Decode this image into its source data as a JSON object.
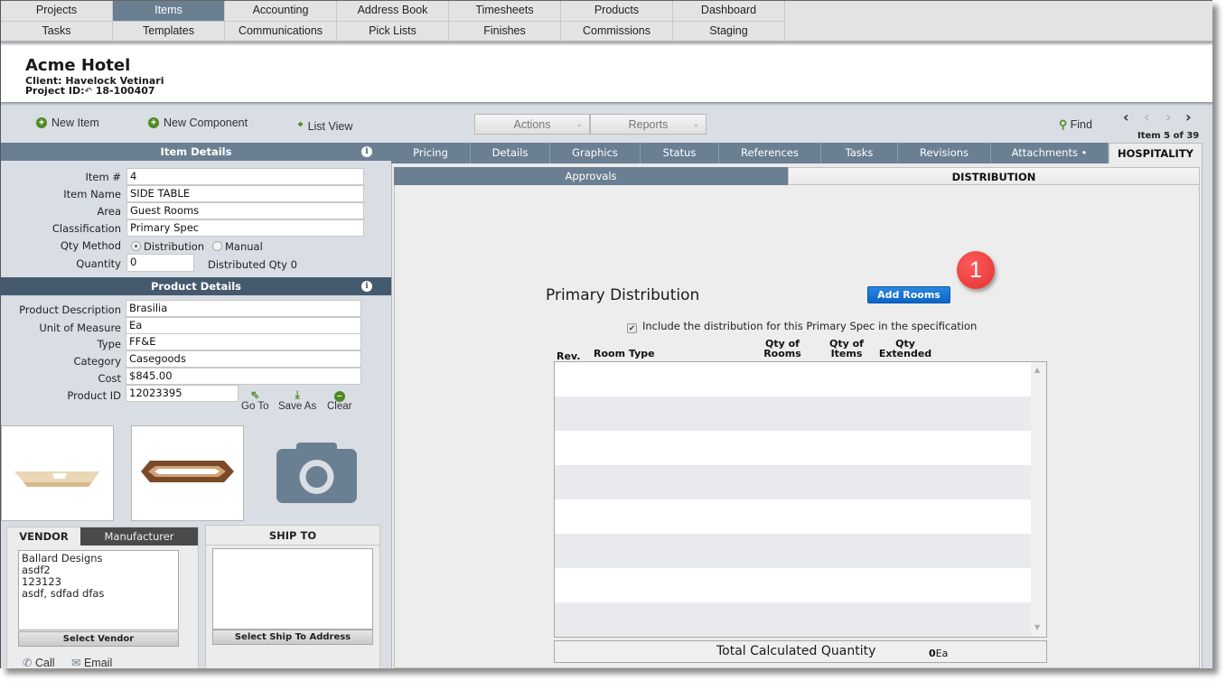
{
  "topnav": {
    "row1": [
      "Projects",
      "Items",
      "Accounting",
      "Address Book",
      "Timesheets",
      "Products",
      "Dashboard"
    ],
    "row2": [
      "Tasks",
      "Templates",
      "Communications",
      "Pick Lists",
      "Finishes",
      "Commissions",
      "Staging"
    ],
    "active": "Items"
  },
  "project": {
    "title": "Acme Hotel",
    "client": "Client: Havelock Vetinari",
    "project_id_label": "Project ID:",
    "project_id": "18-100407"
  },
  "toolbar": {
    "new_item": "New Item",
    "new_component": "New Component",
    "list_view": "List View",
    "actions": "Actions",
    "reports": "Reports",
    "find": "Find",
    "item_count": "Item 5 of 39"
  },
  "item_details": {
    "header": "Item Details",
    "fields": [
      {
        "label": "Item #",
        "value": "4"
      },
      {
        "label": "Item Name",
        "value": "SIDE TABLE"
      },
      {
        "label": "Area",
        "value": "Guest Rooms"
      },
      {
        "label": "Classification",
        "value": "Primary Spec"
      }
    ],
    "qty_method_label": "Qty Method",
    "qty_method_options": [
      "Distribution",
      "Manual"
    ],
    "qty_method_selected": "Distribution",
    "quantity_label": "Quantity",
    "quantity_value": "0",
    "distributed_qty": "Distributed Qty 0"
  },
  "product_details": {
    "header": "Product Details",
    "fields": [
      {
        "label": "Product Description",
        "value": "Brasilia"
      },
      {
        "label": "Unit of Measure",
        "value": "Ea"
      },
      {
        "label": "Type",
        "value": "FF&E"
      },
      {
        "label": "Category",
        "value": "Casegoods"
      },
      {
        "label": "Cost",
        "value": "$845.00"
      }
    ],
    "product_id_label": "Product ID",
    "product_id_value": "12023395",
    "actions": [
      "Go To",
      "Save As",
      "Clear"
    ]
  },
  "vendor": {
    "tabs": [
      "VENDOR",
      "Manufacturer"
    ],
    "active_tab": "VENDOR",
    "address_lines": [
      "Ballard Designs",
      "asdf2",
      "123123",
      "asdf, sdfad dfas"
    ],
    "select_button": "Select Vendor",
    "call": "Call",
    "email": "Email"
  },
  "ship_to": {
    "header": "SHIP TO",
    "select_button": "Select Ship To Address"
  },
  "tabs": {
    "items": [
      "Pricing",
      "Details",
      "Graphics",
      "Status",
      "References",
      "Tasks",
      "Revisions",
      "Attachments •",
      "HOSPITALITY"
    ],
    "active": "HOSPITALITY"
  },
  "subtabs": {
    "items": [
      "Approvals",
      "DISTRIBUTION"
    ],
    "active": "DISTRIBUTION"
  },
  "distribution": {
    "title": "Primary Distribution",
    "add_rooms": "Add Rooms",
    "badge": "1",
    "include_checked": true,
    "include_label": "Include the distribution for this Primary Spec in the specification",
    "columns": {
      "rev": "Rev.",
      "room_type": "Room Type",
      "qty_rooms_1": "Qty of",
      "qty_rooms_2": "Rooms",
      "qty_items_1": "Qty of",
      "qty_items_2": "Items",
      "qty_ext_1": "Qty",
      "qty_ext_2": "Extended"
    },
    "rows": [],
    "total_label": "Total Calculated Quantity",
    "total_value": "0",
    "total_unit": "Ea"
  },
  "colors": {
    "nav_active": "#6b7f92",
    "section_header": "#6b7f92",
    "section_header_dark": "#455a6e",
    "accent_green": "#4e8a23",
    "add_rooms_blue": "#1a75d2",
    "badge_red": "#e83c3c"
  }
}
